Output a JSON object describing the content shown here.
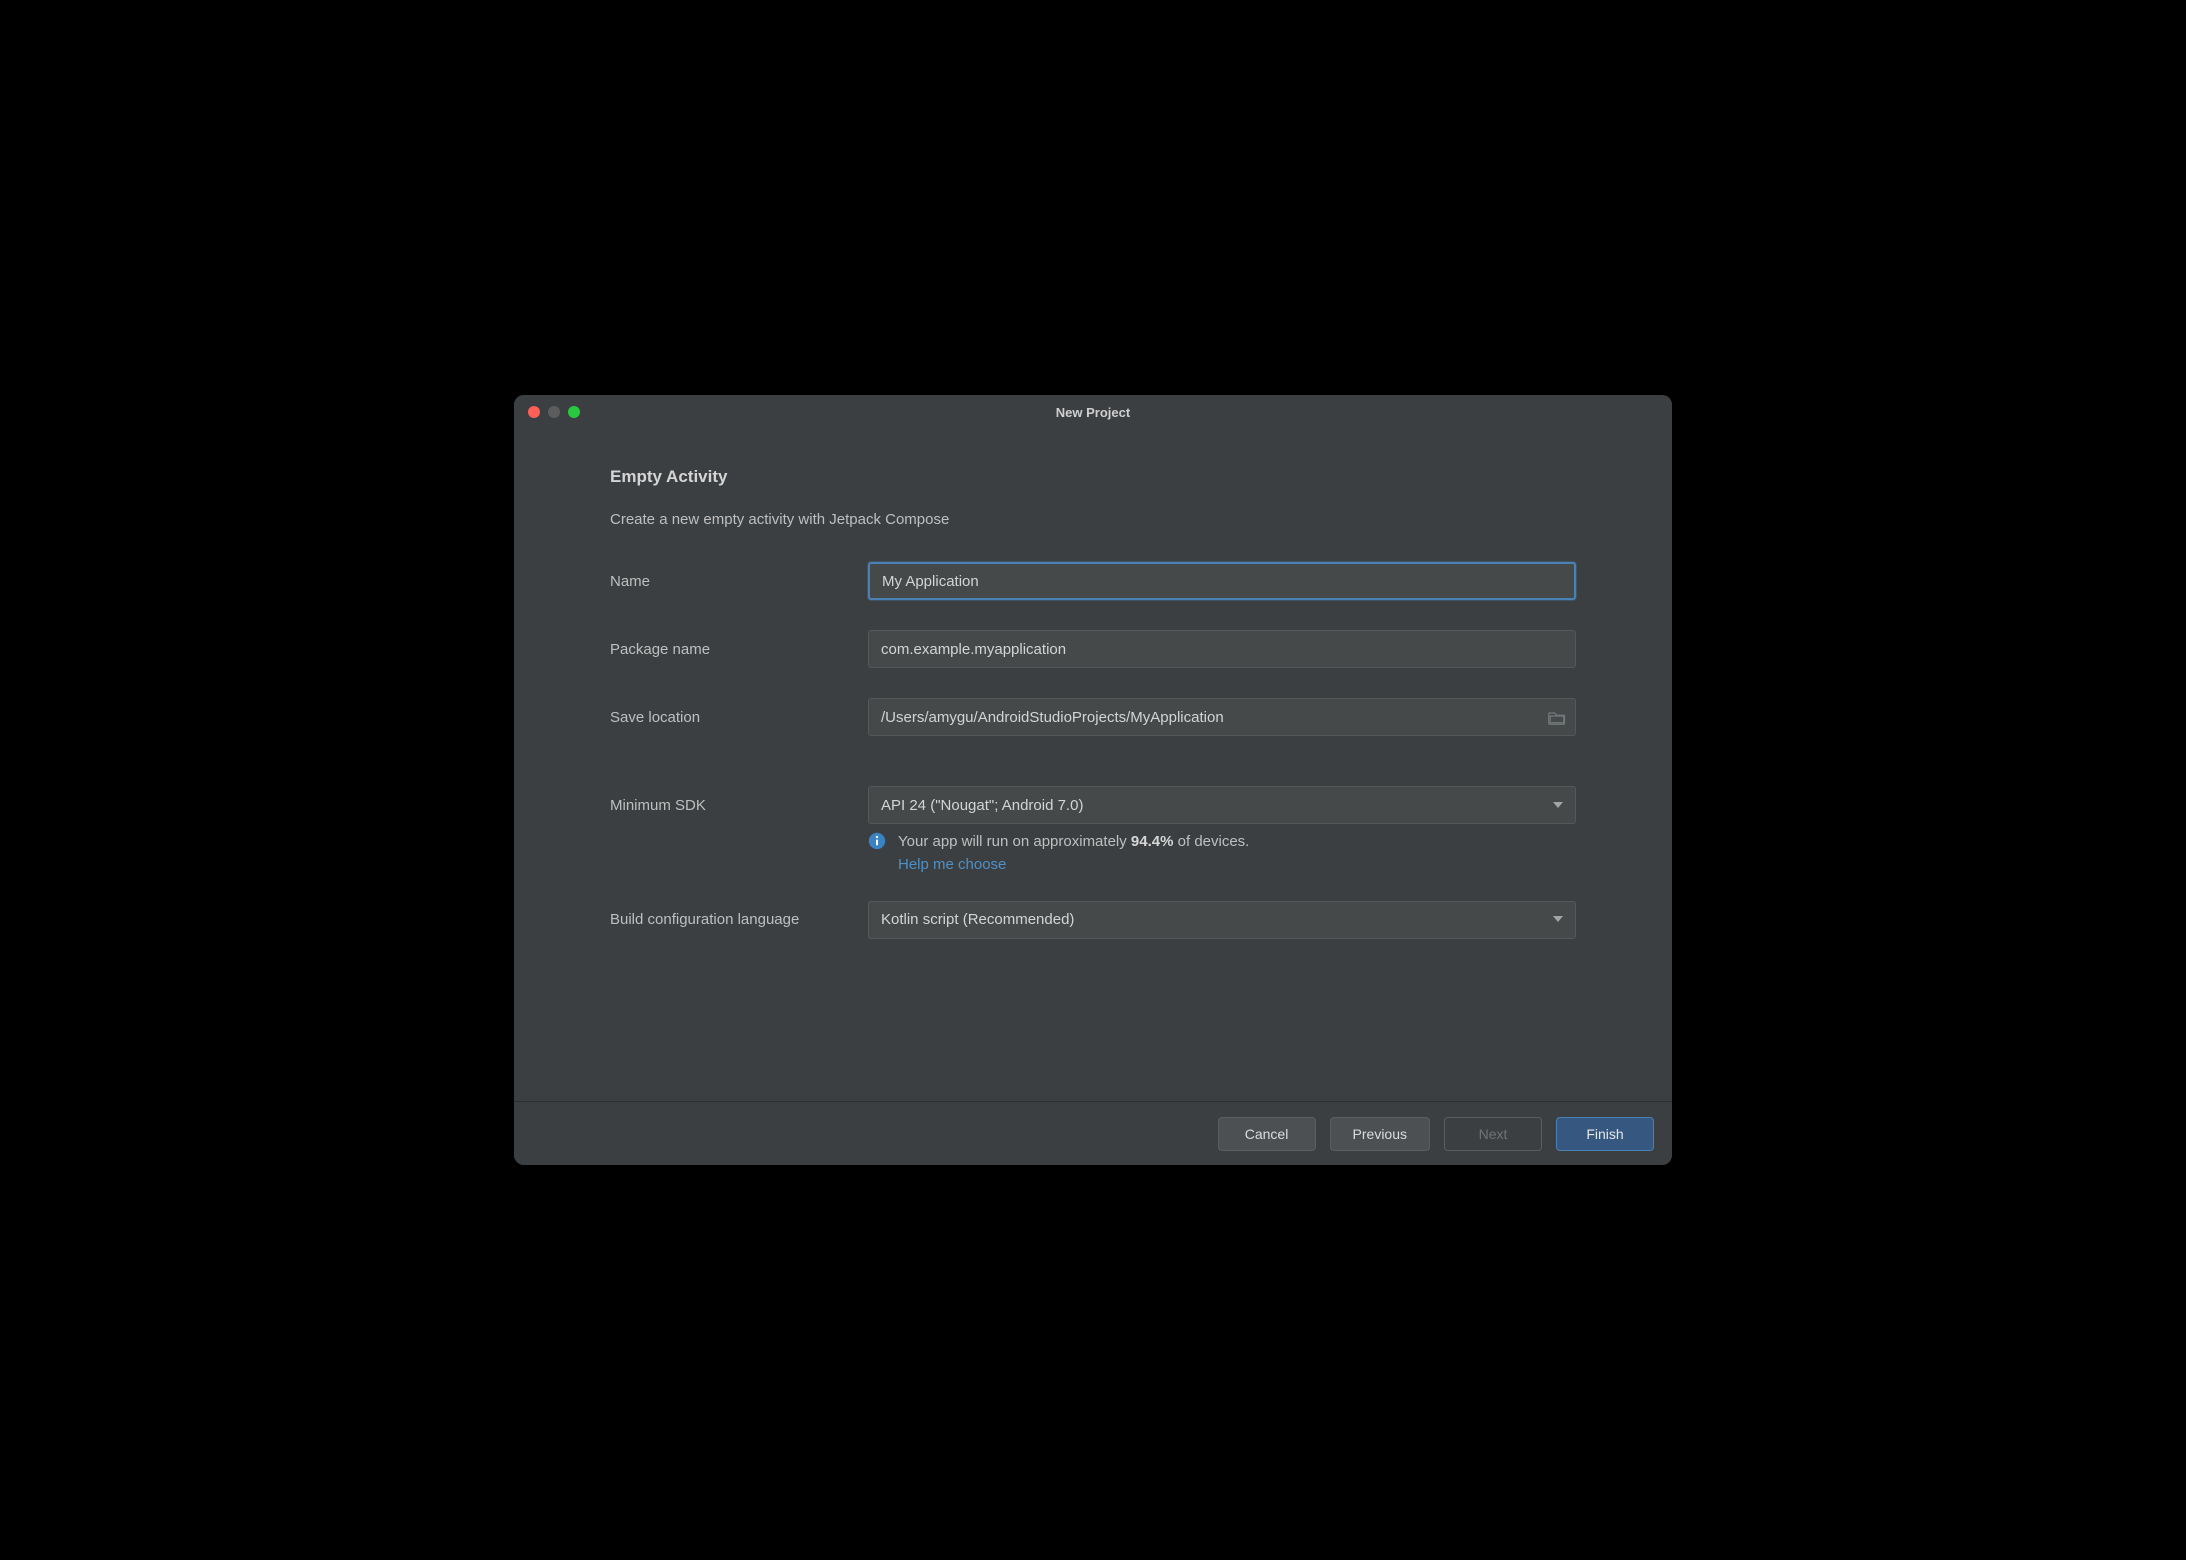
{
  "window": {
    "title": "New Project"
  },
  "heading": "Empty Activity",
  "subtitle": "Create a new empty activity with Jetpack Compose",
  "fields": {
    "name": {
      "label": "Name",
      "value": "My Application"
    },
    "package_name": {
      "label": "Package name",
      "value": "com.example.myapplication"
    },
    "save_location": {
      "label": "Save location",
      "value": "/Users/amygu/AndroidStudioProjects/MyApplication"
    },
    "minimum_sdk": {
      "label": "Minimum SDK",
      "value": "API 24 (\"Nougat\"; Android 7.0)"
    },
    "build_config_lang": {
      "label": "Build configuration language",
      "value": "Kotlin script (Recommended)"
    }
  },
  "sdk_info": {
    "prefix": "Your app will run on approximately ",
    "percent": "94.4%",
    "suffix": " of devices.",
    "help_link": "Help me choose"
  },
  "buttons": {
    "cancel": "Cancel",
    "previous": "Previous",
    "next": "Next",
    "finish": "Finish"
  },
  "colors": {
    "accent": "#4a81b5",
    "link": "#4e90c7",
    "bg": "#3c3f41",
    "input_bg": "#45494a"
  }
}
